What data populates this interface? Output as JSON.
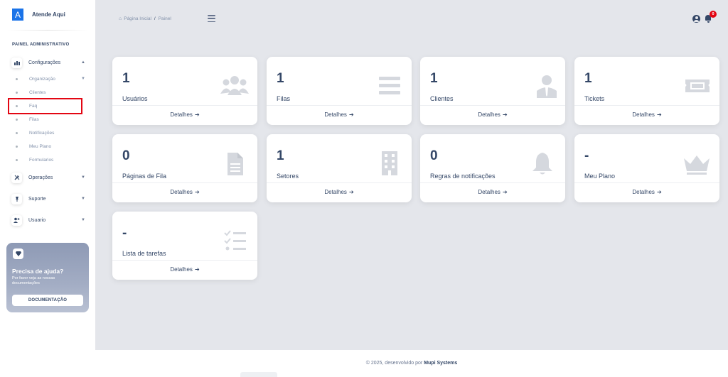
{
  "app": {
    "logo_letter": "A",
    "name": "Atende Aqui"
  },
  "sidebar": {
    "section_label": "PAINEL ADMINISTRATIVO",
    "groups": [
      {
        "label": "Configurações",
        "icon": "chart-bars-icon",
        "expanded": true
      },
      {
        "label": "Operações",
        "icon": "tools-icon",
        "expanded": false
      },
      {
        "label": "Suporte",
        "icon": "pin-icon",
        "expanded": false
      },
      {
        "label": "Usuario",
        "icon": "user-plus-icon",
        "expanded": false
      }
    ],
    "sub_items": [
      {
        "label": "Organização",
        "has_submenu": true
      },
      {
        "label": "Clientes"
      },
      {
        "label": "Faq",
        "highlighted": true
      },
      {
        "label": "Filas"
      },
      {
        "label": "Notificações"
      },
      {
        "label": "Meu Plano"
      },
      {
        "label": "Formularios"
      }
    ]
  },
  "help": {
    "icon": "gem-icon",
    "title": "Precisa de ajuda?",
    "text": "Por favor veja as nossas documentações",
    "button": "DOCUMENTAÇÃO"
  },
  "header": {
    "breadcrumb_home": "Página Inicial",
    "breadcrumb_sep": "/",
    "breadcrumb_current": "Painel",
    "notification_count": "0"
  },
  "cards": [
    {
      "value": "1",
      "title": "Usuários",
      "link": "Detalhes",
      "icon": "users-icon"
    },
    {
      "value": "1",
      "title": "Filas",
      "link": "Detalhes",
      "icon": "queue-icon"
    },
    {
      "value": "1",
      "title": "Clientes",
      "link": "Detalhes",
      "icon": "client-icon"
    },
    {
      "value": "1",
      "title": "Tickets",
      "link": "Detalhes",
      "icon": "ticket-icon"
    },
    {
      "value": "0",
      "title": "Páginas de Fila",
      "link": "Detalhes",
      "icon": "document-icon"
    },
    {
      "value": "1",
      "title": "Setores",
      "link": "Detalhes",
      "icon": "building-icon"
    },
    {
      "value": "0",
      "title": "Regras de notificações",
      "link": "Detalhes",
      "icon": "bell-icon"
    },
    {
      "value": "-",
      "title": "Meu Plano",
      "link": "Detalhes",
      "icon": "crown-icon"
    },
    {
      "value": "-",
      "title": "Lista de tarefas",
      "link": "Detalhes",
      "icon": "checklist-icon"
    }
  ],
  "footer": {
    "text": "© 2025, desenvolvido por",
    "company": "Mupi Systems"
  },
  "colors": {
    "brand": "#1a73e8",
    "text_dark": "#344767",
    "highlight": "#e30613",
    "background": "#e4e6eb"
  }
}
